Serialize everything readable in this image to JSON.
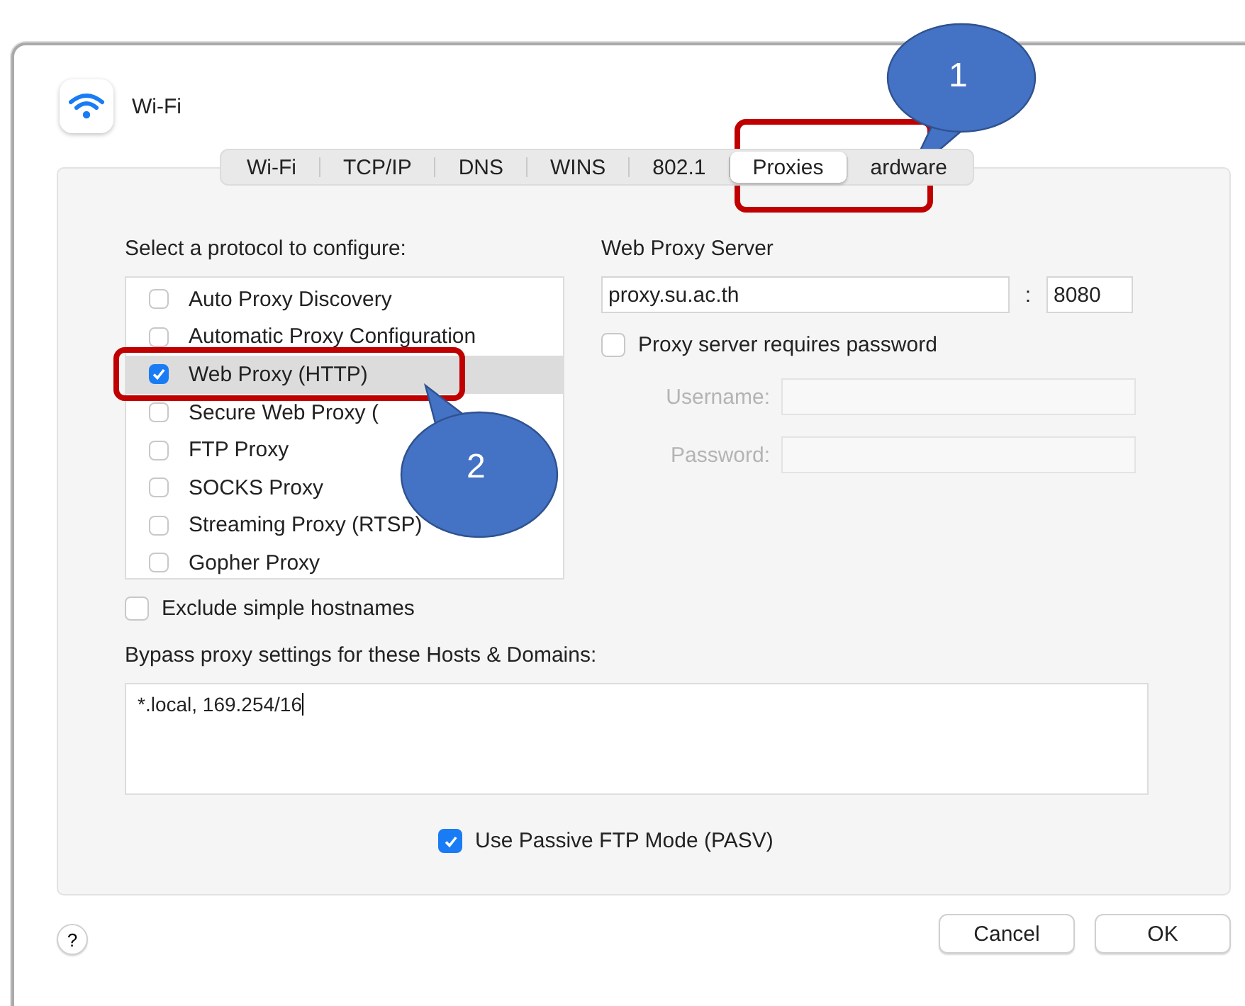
{
  "window": {
    "title": "Wi-Fi"
  },
  "tabs": [
    {
      "label": "Wi-Fi",
      "selected": false
    },
    {
      "label": "TCP/IP",
      "selected": false
    },
    {
      "label": "DNS",
      "selected": false
    },
    {
      "label": "WINS",
      "selected": false
    },
    {
      "label": "802.1",
      "selected": false
    },
    {
      "label": "Proxies",
      "selected": true
    },
    {
      "label": "ardware",
      "selected": false
    }
  ],
  "protocols": {
    "label": "Select a protocol to configure:",
    "items": [
      {
        "name": "Auto Proxy Discovery",
        "checked": false,
        "selected": false
      },
      {
        "name": "Automatic Proxy Configuration",
        "checked": false,
        "selected": false
      },
      {
        "name": "Web Proxy (HTTP)",
        "checked": true,
        "selected": true
      },
      {
        "name": "Secure Web Proxy (",
        "checked": false,
        "selected": false
      },
      {
        "name": "FTP Proxy",
        "checked": false,
        "selected": false
      },
      {
        "name": "SOCKS Proxy",
        "checked": false,
        "selected": false
      },
      {
        "name": "Streaming Proxy (RTSP)",
        "checked": false,
        "selected": false
      },
      {
        "name": "Gopher Proxy",
        "checked": false,
        "selected": false
      }
    ]
  },
  "server": {
    "label": "Web Proxy Server",
    "host": "proxy.su.ac.th",
    "separator": ":",
    "port": "8080",
    "requires_password": {
      "label": "Proxy server requires password",
      "checked": false
    },
    "username": {
      "label": "Username:",
      "disabled": true
    },
    "password": {
      "label": "Password:",
      "disabled": true
    }
  },
  "exclude_simple": {
    "label": "Exclude simple hostnames",
    "checked": false
  },
  "bypass": {
    "label": "Bypass proxy settings for these Hosts & Domains:",
    "value": "*.local, 169.254/16"
  },
  "passive_ftp": {
    "label": "Use Passive FTP Mode (PASV)",
    "checked": true
  },
  "help": "?",
  "buttons": [
    "Cancel",
    "OK"
  ],
  "annotations": [
    {
      "label": "1"
    },
    {
      "label": "2"
    }
  ]
}
